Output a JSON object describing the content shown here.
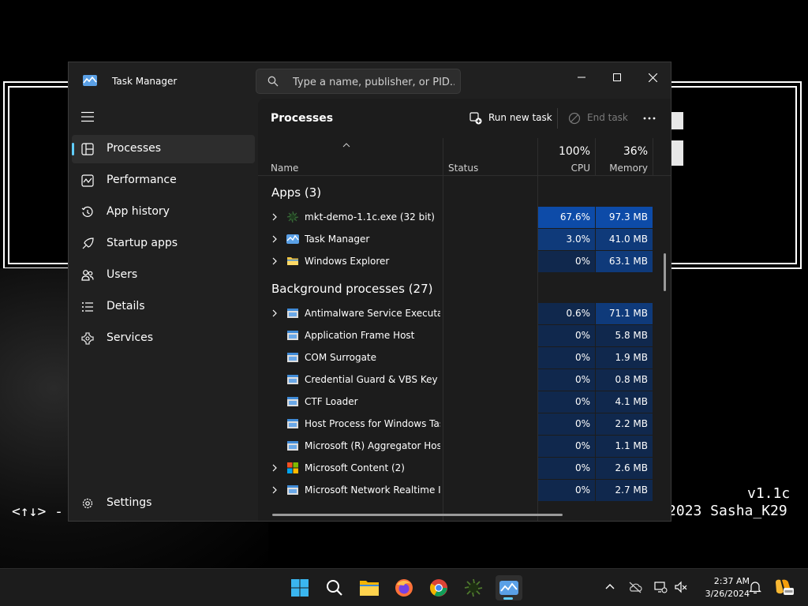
{
  "background_app": {
    "version": "v1.1c",
    "credit": "2023 Sasha_K29",
    "hint": "<↑↓> -"
  },
  "window": {
    "title": "Task Manager",
    "search_placeholder": "Type a name, publisher, or PID..."
  },
  "sidebar": {
    "items": [
      {
        "label": "Processes",
        "icon": "processes-icon"
      },
      {
        "label": "Performance",
        "icon": "performance-icon"
      },
      {
        "label": "App history",
        "icon": "history-icon"
      },
      {
        "label": "Startup apps",
        "icon": "startup-icon"
      },
      {
        "label": "Users",
        "icon": "users-icon"
      },
      {
        "label": "Details",
        "icon": "details-icon"
      },
      {
        "label": "Services",
        "icon": "services-icon"
      }
    ],
    "settings_label": "Settings"
  },
  "content": {
    "title": "Processes",
    "run_new_task": "Run new task",
    "end_task": "End task",
    "columns": {
      "name": "Name",
      "status": "Status",
      "cpu_pct": "100%",
      "cpu": "CPU",
      "memory_pct": "36%",
      "memory": "Memory"
    },
    "apps_group": "Apps (3)",
    "apps": [
      {
        "name": "mkt-demo-1.1c.exe (32 bit)",
        "cpu": "67.6%",
        "memory": "97.3 MB"
      },
      {
        "name": "Task Manager",
        "cpu": "3.0%",
        "memory": "41.0 MB"
      },
      {
        "name": "Windows Explorer",
        "cpu": "0%",
        "memory": "63.1 MB"
      }
    ],
    "background_group": "Background processes (27)",
    "background": [
      {
        "name": "Antimalware Service Executable",
        "cpu": "0.6%",
        "memory": "71.1 MB"
      },
      {
        "name": "Application Frame Host",
        "cpu": "0%",
        "memory": "5.8 MB"
      },
      {
        "name": "COM Surrogate",
        "cpu": "0%",
        "memory": "1.9 MB"
      },
      {
        "name": "Credential Guard & VBS Key Is...",
        "cpu": "0%",
        "memory": "0.8 MB"
      },
      {
        "name": "CTF Loader",
        "cpu": "0%",
        "memory": "4.1 MB"
      },
      {
        "name": "Host Process for Windows Tasks",
        "cpu": "0%",
        "memory": "2.2 MB"
      },
      {
        "name": "Microsoft (R) Aggregator Host",
        "cpu": "0%",
        "memory": "1.1 MB"
      },
      {
        "name": "Microsoft Content (2)",
        "cpu": "0%",
        "memory": "2.6 MB"
      },
      {
        "name": "Microsoft Network Realtime I...",
        "cpu": "0%",
        "memory": "2.7 MB"
      }
    ]
  },
  "taskbar": {
    "time": "2:37 AM",
    "date": "3/26/2024"
  },
  "colors": {
    "accent": "#60cdff",
    "heat_high": "#0d4ba8",
    "heat_mid": "#0f3a7a",
    "heat_low": "#10284d"
  }
}
